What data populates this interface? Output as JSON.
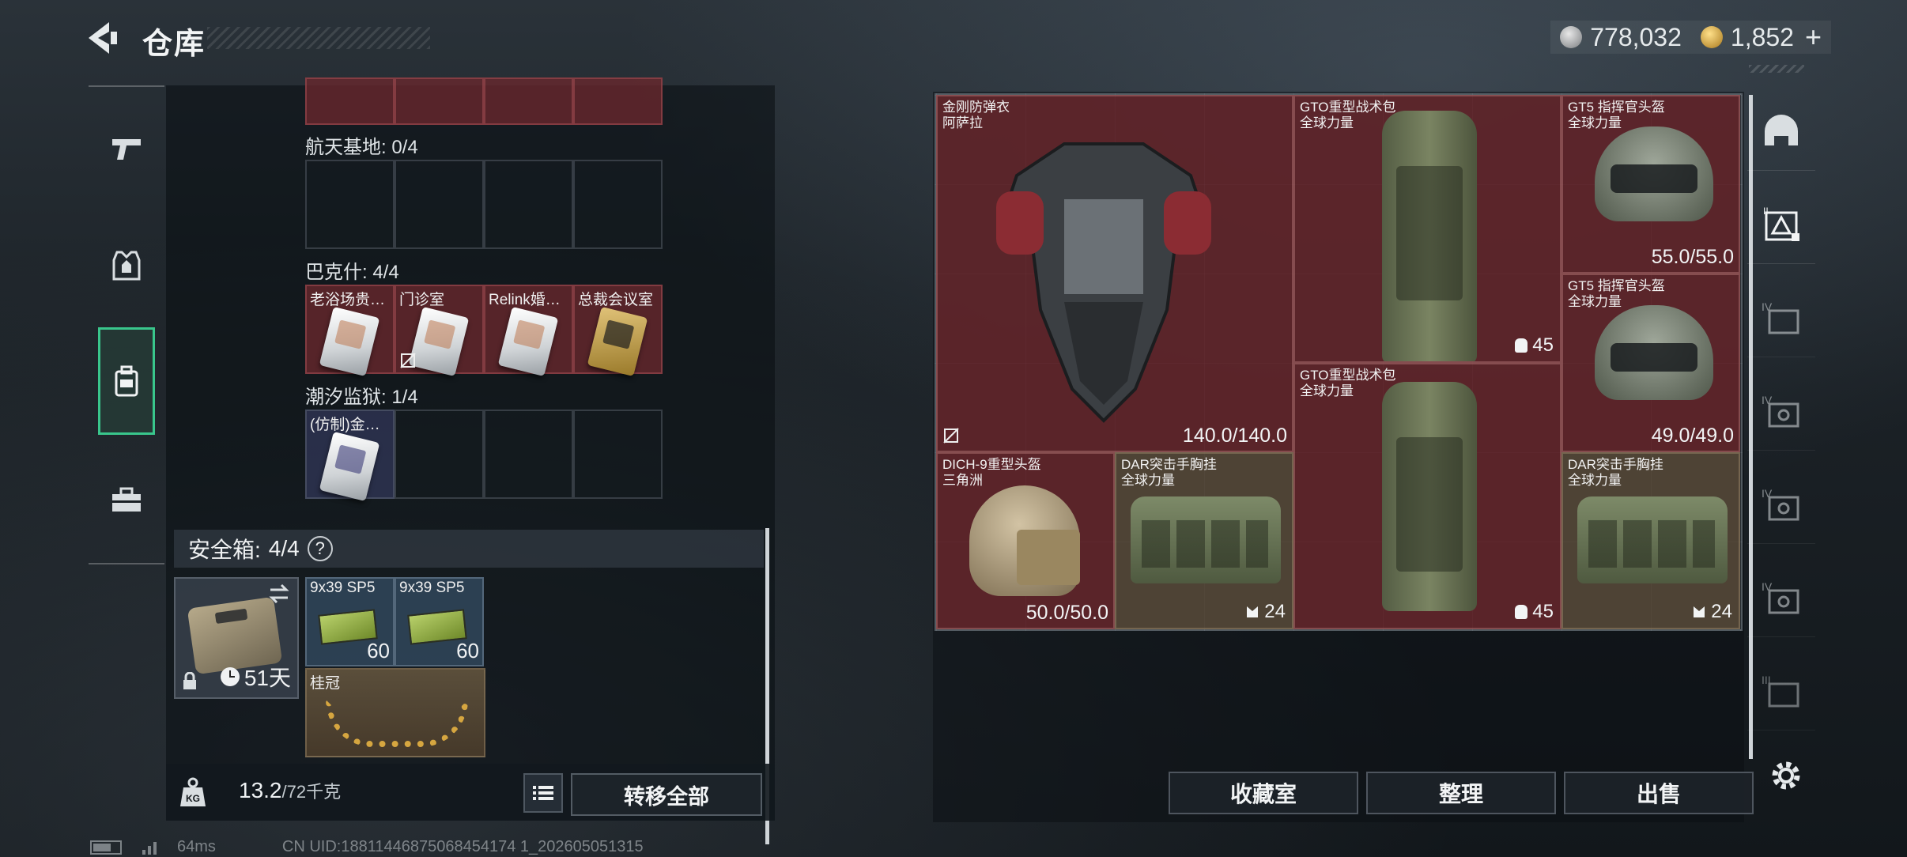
{
  "header": {
    "title": "仓库",
    "currency_silver": "778,032",
    "currency_gold": "1,852",
    "add_label": "+"
  },
  "left_rail": [
    {
      "icon": "pistol-icon"
    },
    {
      "icon": "armor-icon"
    },
    {
      "icon": "backpack-icon",
      "active": true
    },
    {
      "icon": "toolbox-icon"
    }
  ],
  "stash": {
    "maps": [
      {
        "label": "航天基地: 0/4",
        "items": []
      },
      {
        "label": "巴克什: 4/4",
        "items": [
          "老浴场贵…",
          "门诊室",
          "Relink婚…",
          "总裁会议室"
        ]
      },
      {
        "label": "潮汐监狱: 1/4",
        "items": [
          "(仿制)金…"
        ]
      }
    ],
    "safe_label": "安全箱:",
    "safe_count": "4/4",
    "help": "?",
    "safe_days": "51天",
    "ammo": [
      {
        "name": "9x39 SP5",
        "count": "60"
      },
      {
        "name": "9x39 SP5",
        "count": "60"
      }
    ],
    "laurel": "桂冠",
    "weight_value": "13.2",
    "weight_max": "/72千克",
    "transfer_label": "转移全部"
  },
  "loot": [
    {
      "name": "金刚防弹衣",
      "sub": "阿萨拉",
      "durability": "140.0/140.0"
    },
    {
      "name": "GTO重型战术包",
      "sub": "全球力量",
      "capacity": "45"
    },
    {
      "name": "GT5 指挥官头盔",
      "sub": "全球力量",
      "durability": "55.0/55.0"
    },
    {
      "name": "GT5 指挥官头盔",
      "sub": "全球力量",
      "durability": "49.0/49.0"
    },
    {
      "name": "GTO重型战术包",
      "sub": "全球力量",
      "capacity": "45"
    },
    {
      "name": "DICH-9重型头盔",
      "sub": "三角洲",
      "durability": "50.0/50.0"
    },
    {
      "name": "DAR突击手胸挂",
      "sub": "全球力量",
      "capacity": "24"
    },
    {
      "name": "DAR突击手胸挂",
      "sub": "全球力量",
      "capacity": "24"
    }
  ],
  "actions": {
    "collection": "收藏室",
    "sort": "整理",
    "sell": "出售"
  },
  "right_rail": [
    {
      "icon": "helmet-slot-icon"
    },
    {
      "icon": "container-slot-icon",
      "active": true
    },
    {
      "icon": "container-iv-icon"
    },
    {
      "icon": "container-iv-icon"
    },
    {
      "icon": "container-iv-icon"
    },
    {
      "icon": "container-iv-icon"
    },
    {
      "icon": "container-iii-icon"
    }
  ],
  "footer": {
    "ping": "64ms",
    "uid": "CN UID:18811446875068454174 1_202605051315"
  },
  "colors": {
    "accent_green": "#39c68c",
    "item_red": "#6e282d",
    "item_tan": "#5f503c"
  }
}
